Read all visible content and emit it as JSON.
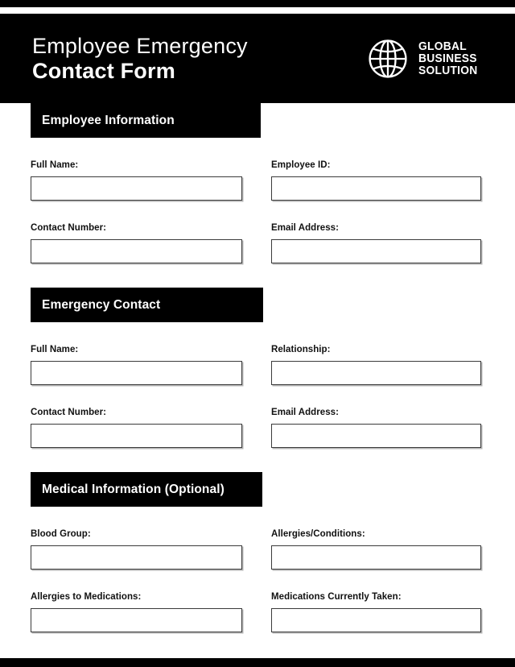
{
  "header": {
    "title_line1": "Employee Emergency",
    "title_line2": "Contact Form",
    "logo": {
      "icon": "globe-icon",
      "line1": "GLOBAL",
      "line2": "BUSINESS",
      "line3": "SOLUTION"
    }
  },
  "sections": [
    {
      "title": "Employee Information",
      "fields": [
        {
          "label": "Full Name:",
          "value": "",
          "placeholder": ""
        },
        {
          "label": "Employee ID:",
          "value": "",
          "placeholder": ""
        },
        {
          "label": "Contact Number:",
          "value": "",
          "placeholder": ""
        },
        {
          "label": "Email Address:",
          "value": "",
          "placeholder": ""
        }
      ]
    },
    {
      "title": "Emergency Contact",
      "fields": [
        {
          "label": "Full Name:",
          "value": "",
          "placeholder": ""
        },
        {
          "label": "Relationship:",
          "value": "",
          "placeholder": ""
        },
        {
          "label": "Contact Number:",
          "value": "",
          "placeholder": ""
        },
        {
          "label": "Email Address:",
          "value": "",
          "placeholder": ""
        }
      ]
    },
    {
      "title": "Medical Information (Optional)",
      "fields": [
        {
          "label": "Blood Group:",
          "value": "",
          "placeholder": ""
        },
        {
          "label": "Allergies/Conditions:",
          "value": "",
          "placeholder": ""
        },
        {
          "label": "Allergies to Medications:",
          "value": "",
          "placeholder": ""
        },
        {
          "label": "Medications Currently Taken:",
          "value": "",
          "placeholder": ""
        }
      ]
    }
  ],
  "colors": {
    "brand_black": "#000000",
    "page_background": "#ffffff",
    "input_border": "#3b3b3b",
    "text": "#111111"
  }
}
